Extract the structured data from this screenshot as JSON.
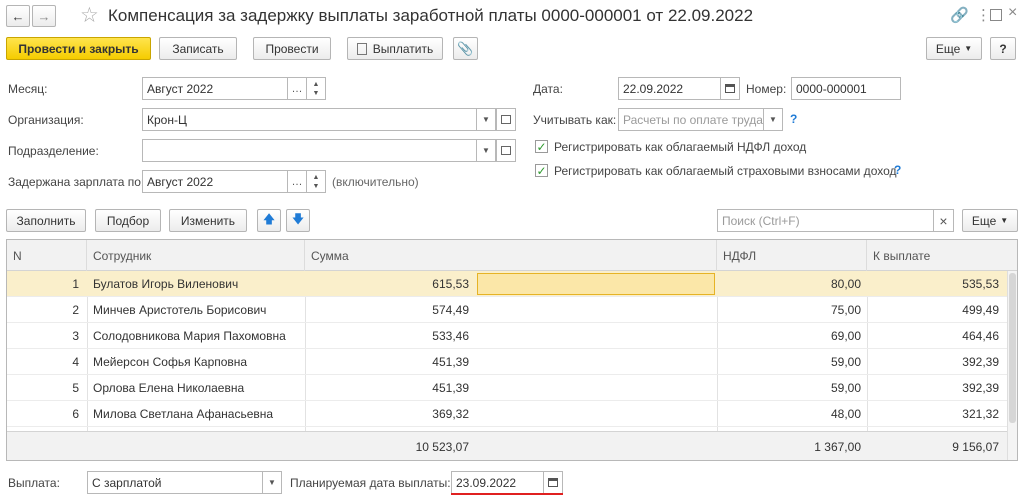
{
  "window": {
    "title": "Компенсация за задержку выплаты заработной платы 0000-000001 от 22.09.2022"
  },
  "toolbar": {
    "post_close": "Провести и закрыть",
    "save": "Записать",
    "post": "Провести",
    "pay": "Выплатить",
    "more": "Еще",
    "help": "?"
  },
  "form": {
    "month_label": "Месяц:",
    "month_value": "Август 2022",
    "org_label": "Организация:",
    "org_value": "Крон-Ц",
    "dept_label": "Подразделение:",
    "dept_value": "",
    "delayed_label": "Задержана зарплата по:",
    "delayed_value": "Август 2022",
    "delayed_hint": "(включительно)",
    "date_label": "Дата:",
    "date_value": "22.09.2022",
    "number_label": "Номер:",
    "number_value": "0000-000001",
    "account_label": "Учитывать как:",
    "account_placeholder": "Расчеты по оплате труда",
    "ndfl_check": "Регистрировать как облагаемый НДФЛ доход",
    "ins_check": "Регистрировать как облагаемый страховыми взносами доход",
    "help_mark": "?"
  },
  "table_toolbar": {
    "fill": "Заполнить",
    "pick": "Подбор",
    "edit": "Изменить",
    "search_placeholder": "Поиск (Ctrl+F)",
    "clear": "×",
    "more": "Еще"
  },
  "table": {
    "columns": {
      "n": "N",
      "employee": "Сотрудник",
      "sum": "Сумма",
      "ndfl": "НДФЛ",
      "pay": "К выплате"
    },
    "rows": [
      {
        "n": "1",
        "employee": "Булатов Игорь Виленович",
        "sum": "615,53",
        "ndfl": "80,00",
        "pay": "535,53"
      },
      {
        "n": "2",
        "employee": "Минчев Аристотель Борисович",
        "sum": "574,49",
        "ndfl": "75,00",
        "pay": "499,49"
      },
      {
        "n": "3",
        "employee": "Солодовникова Мария Пахомовна",
        "sum": "533,46",
        "ndfl": "69,00",
        "pay": "464,46"
      },
      {
        "n": "4",
        "employee": "Мейерсон Софья Карповна",
        "sum": "451,39",
        "ndfl": "59,00",
        "pay": "392,39"
      },
      {
        "n": "5",
        "employee": "Орлова Елена Николаевна",
        "sum": "451,39",
        "ndfl": "59,00",
        "pay": "392,39"
      },
      {
        "n": "6",
        "employee": "Милова Светлана Афанасьевна",
        "sum": "369,32",
        "ndfl": "48,00",
        "pay": "321,32"
      }
    ],
    "totals": {
      "sum": "10 523,07",
      "ndfl": "1 367,00",
      "pay": "9 156,07"
    }
  },
  "bottom": {
    "payout_label": "Выплата:",
    "payout_value": "С зарплатой",
    "planned_label": "Планируемая дата выплаты:",
    "planned_value": "23.09.2022"
  },
  "colors": {
    "primary": "#f5cc00",
    "selection": "#faefcb",
    "underline": "#e02020",
    "help": "#1f7bd6"
  }
}
